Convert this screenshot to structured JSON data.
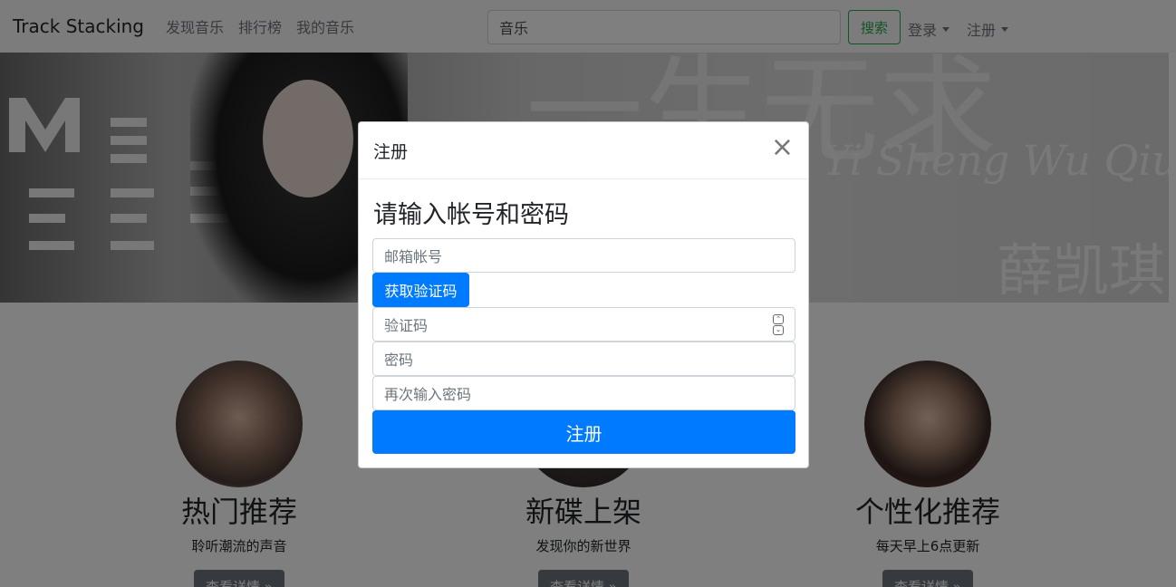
{
  "navbar": {
    "brand": "Track Stacking",
    "links": [
      "发现音乐",
      "排行榜",
      "我的音乐"
    ],
    "search_value": "音乐",
    "search_button": "搜索",
    "login": "登录",
    "register": "注册"
  },
  "banner": {
    "script_text": "Yi Sheng Wu Qiu",
    "artist": "薛凯琪",
    "big_text": "一生无求"
  },
  "features": [
    {
      "title": "热门推荐",
      "subtitle": "聆听潮流的声音",
      "button": "查看详情 »"
    },
    {
      "title": "新碟上架",
      "subtitle": "发现你的新世界",
      "button": "查看详情 »"
    },
    {
      "title": "个性化推荐",
      "subtitle": "每天早上6点更新",
      "button": "查看详情 »"
    }
  ],
  "modal": {
    "title": "注册",
    "close": "×",
    "heading": "请输入帐号和密码",
    "email_placeholder": "邮箱帐号",
    "get_code_button": "获取验证码",
    "code_placeholder": "验证码",
    "password_placeholder": "密码",
    "confirm_placeholder": "再次输入密码",
    "submit_button": "注册"
  },
  "colors": {
    "primary": "#007bff",
    "success": "#28a745",
    "secondary": "#6c757d"
  }
}
